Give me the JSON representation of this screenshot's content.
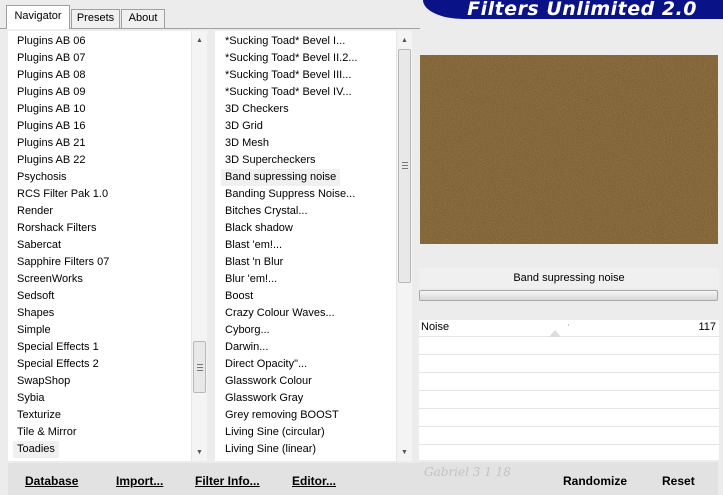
{
  "tabs": [
    {
      "label": "Navigator",
      "active": true
    },
    {
      "label": "Presets",
      "active": false
    },
    {
      "label": "About",
      "active": false
    }
  ],
  "app_title": "Filters Unlimited 2.0",
  "categories": {
    "items": [
      "Plugins AB 06",
      "Plugins AB 07",
      "Plugins AB 08",
      "Plugins AB 09",
      "Plugins AB 10",
      "Plugins AB 16",
      "Plugins AB 21",
      "Plugins AB 22",
      "Psychosis",
      "RCS Filter Pak 1.0",
      "Render",
      "Rorshack Filters",
      "Sabercat",
      "Sapphire Filters 07",
      "ScreenWorks",
      "Sedsoft",
      "Shapes",
      "Simple",
      "Special Effects 1",
      "Special Effects 2",
      "SwapShop",
      "Sybia",
      "Texturize",
      "Tile & Mirror",
      "Toadies"
    ],
    "selected": "Toadies"
  },
  "filters": {
    "items": [
      "*Sucking Toad*  Bevel I...",
      "*Sucking Toad*  Bevel II.2...",
      "*Sucking Toad*  Bevel III...",
      "*Sucking Toad*  Bevel IV...",
      "3D Checkers",
      "3D Grid",
      "3D Mesh",
      "3D Supercheckers",
      "Band supressing noise",
      "Banding Suppress Noise...",
      "Bitches Crystal...",
      "Black shadow",
      "Blast 'em!...",
      "Blast 'n Blur",
      "Blur 'em!...",
      "Boost",
      "Crazy Colour Waves...",
      "Cyborg...",
      "Darwin...",
      "Direct Opacity\"...",
      "Glasswork Colour",
      "Glasswork Gray",
      "Grey removing BOOST",
      "Living Sine (circular)",
      "Living Sine (linear)"
    ],
    "selected": "Band supressing noise"
  },
  "preview": {
    "color": "#806234"
  },
  "current_filter": "Band supressing noise",
  "params": [
    {
      "label": "Noise",
      "value": "117",
      "fraction": 0.46
    }
  ],
  "buttons": {
    "database": "Database",
    "import": "Import...",
    "filter_info": "Filter Info...",
    "editor": "Editor...",
    "randomize": "Randomize",
    "reset": "Reset"
  },
  "watermark": "Gabriel 3 1 18"
}
